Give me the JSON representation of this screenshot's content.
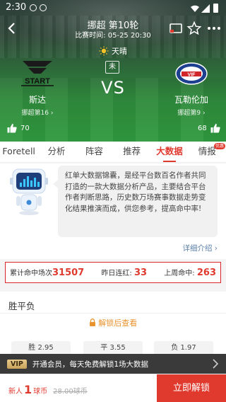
{
  "status_bar": {
    "time": "2:30"
  },
  "header": {
    "title": "挪超 第10轮",
    "subtitle": "比赛时间: 05-25 20:30"
  },
  "match": {
    "weather": "天晴",
    "status": "未",
    "vs": "VS",
    "home": {
      "name": "斯达",
      "rank": "挪超第16",
      "logo_text": "START",
      "likes": "70"
    },
    "away": {
      "name": "瓦勒伦加",
      "rank": "挪超第9",
      "logo_text": "VIF",
      "likes": "68"
    }
  },
  "tabs": [
    {
      "label": "Foretell"
    },
    {
      "label": "分析"
    },
    {
      "label": "阵容"
    },
    {
      "label": "推荐"
    },
    {
      "label": "大数据",
      "active": true
    },
    {
      "label": "情报",
      "badge": "优惠"
    }
  ],
  "intro": {
    "text": "红单大数据锦囊，是经平台数百名作者共同打造的一款大数据分析产品，主要结合平台作者判断思路，历史数万场赛事数据走势变化结果推演而成，供您参考，提高命中率!",
    "detail_link": "详细介绍"
  },
  "stats": {
    "total_label": "累计命中场次",
    "total_value": "31507",
    "streak_label": "昨日连红:",
    "streak_value": "33",
    "lastweek_label": "上周命中:",
    "lastweek_value": "263"
  },
  "outcome": {
    "title": "胜平负",
    "unlock_hint": "解锁后查看",
    "options": [
      {
        "label": "胜 2.95"
      },
      {
        "label": "平 3.55"
      },
      {
        "label": "负 1.97"
      }
    ]
  },
  "vip_bar": {
    "badge": "VIP",
    "text": "开通会员，每天免费解锁1场大数据"
  },
  "bottom_bar": {
    "price_prefix": "新人",
    "price_value": "1",
    "price_unit": "球币",
    "price_original": "28.00球币",
    "unlock_button": "立即解锁"
  },
  "colors": {
    "accent": "#e03a2f",
    "hint_orange": "#e8932d",
    "link_blue": "#5a7fa8",
    "vip_gold": "#c9a25a"
  }
}
